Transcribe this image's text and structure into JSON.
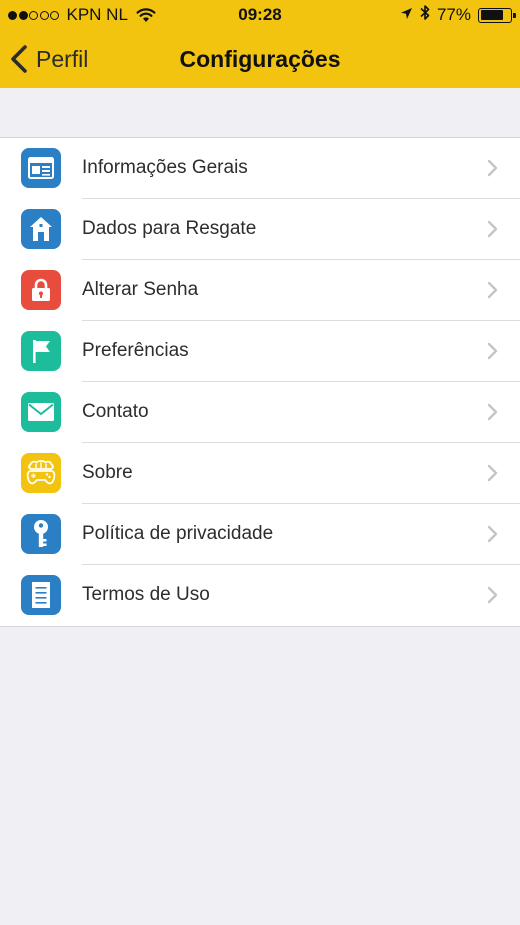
{
  "status_bar": {
    "signal_bars_filled": 2,
    "signal_bars_total": 5,
    "carrier": "KPN NL",
    "time": "09:28",
    "battery_percent_label": "77%",
    "battery_level": 0.77
  },
  "nav": {
    "back_label": "Perfil",
    "title": "Configurações"
  },
  "settings": [
    {
      "label": "Informações Gerais",
      "icon": "newspaper-icon",
      "color": "#2b7fc4"
    },
    {
      "label": "Dados para Resgate",
      "icon": "house-icon",
      "color": "#2b7fc4"
    },
    {
      "label": "Alterar Senha",
      "icon": "lock-icon",
      "color": "#e74c3c"
    },
    {
      "label": "Preferências",
      "icon": "flag-icon",
      "color": "#1dbc9b"
    },
    {
      "label": "Contato",
      "icon": "envelope-icon",
      "color": "#1dbc9b"
    },
    {
      "label": "Sobre",
      "icon": "brain-gamepad-icon",
      "color": "#f2c40f"
    },
    {
      "label": "Política de privacidade",
      "icon": "key-icon",
      "color": "#2b7fc4"
    },
    {
      "label": "Termos de Uso",
      "icon": "document-icon",
      "color": "#2b7fc4"
    }
  ],
  "colors": {
    "header": "#f2c40f",
    "background": "#efeff4"
  }
}
